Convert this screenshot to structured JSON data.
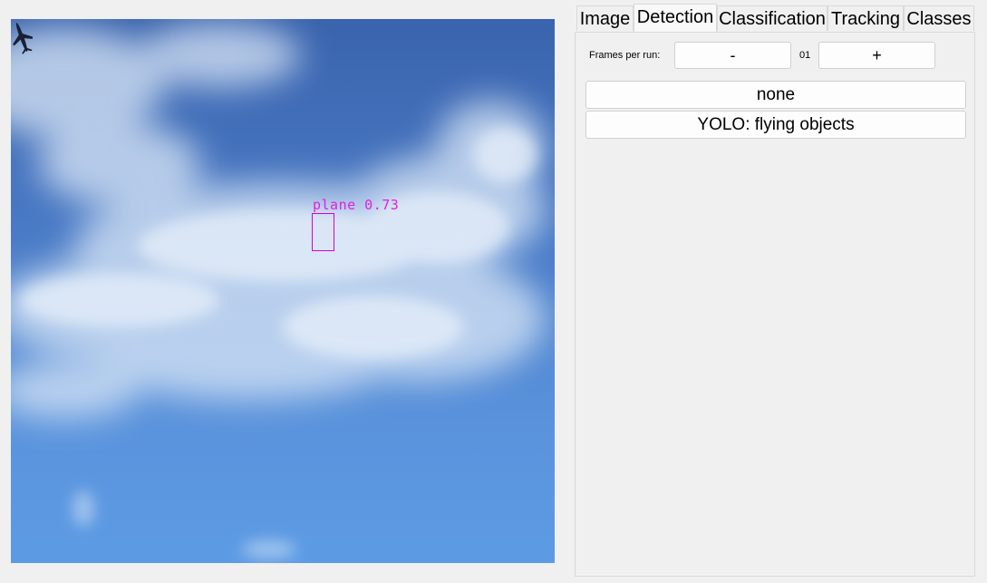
{
  "tabs": [
    "Image",
    "Detection",
    "Classification",
    "Tracking",
    "Classes"
  ],
  "active_tab": "Detection",
  "detection": {
    "frames_label": "Frames per run:",
    "minus_label": "-",
    "plus_label": "+",
    "frames_value": "01",
    "models": [
      "none",
      "YOLO: flying objects"
    ]
  },
  "viewer": {
    "detection_label": "plane  0.73",
    "box_color": "#d400d4",
    "icon": "airplane-icon"
  }
}
